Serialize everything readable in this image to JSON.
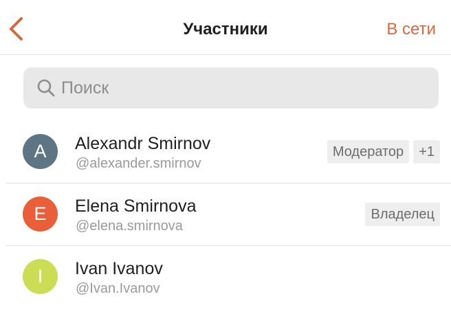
{
  "header": {
    "title": "Участники",
    "online_label": "В сети",
    "accent_color": "#d06a3e"
  },
  "search": {
    "placeholder": "Поиск",
    "value": ""
  },
  "members": [
    {
      "initial": "A",
      "name": "Alexandr Smirnov",
      "handle": "@alexander.smirnov",
      "avatar_color": "#5e7584",
      "badges": [
        "Модератор",
        "+1"
      ]
    },
    {
      "initial": "E",
      "name": "Elena Smirnova",
      "handle": "@elena.smirnova",
      "avatar_color": "#e95f3a",
      "badges": [
        "Владелец"
      ]
    },
    {
      "initial": "I",
      "name": "Ivan Ivanov",
      "handle": "@Ivan.Ivanov",
      "avatar_color": "#cbdc55",
      "badges": []
    }
  ]
}
